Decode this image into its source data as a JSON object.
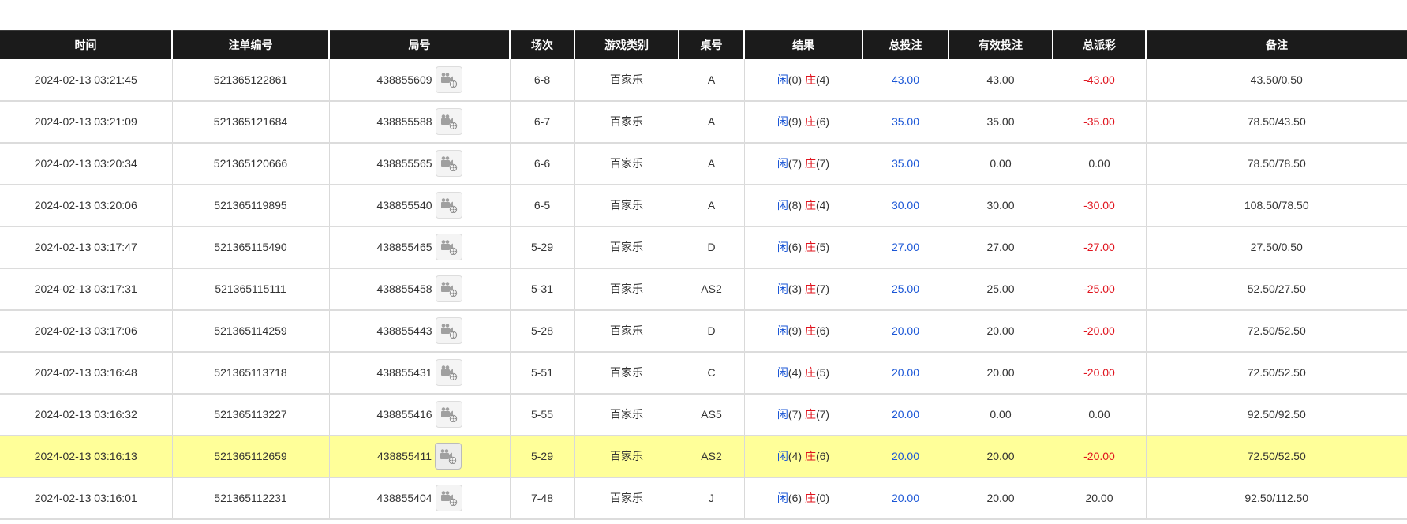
{
  "columns": [
    "时间",
    "注单编号",
    "局号",
    "场次",
    "游戏类别",
    "桌号",
    "结果",
    "总投注",
    "有效投注",
    "总派彩",
    "备注"
  ],
  "labels": {
    "player": "闲",
    "banker": "庄"
  },
  "icons": {
    "replay": "video-camera-icon"
  },
  "colors": {
    "header_bg": "#1b1b1b",
    "highlight": "#ffff99",
    "blue": "#1a56d6",
    "red": "#e0141e"
  },
  "rows": [
    {
      "time": "2024-02-13 03:21:45",
      "bet_id": "521365122861",
      "round": "438855609",
      "session": "6-8",
      "game": "百家乐",
      "table": "A",
      "player_score": "(0)",
      "banker_score": "(4)",
      "total_bet": "43.00",
      "valid_bet": "43.00",
      "payout": "-43.00",
      "note": "43.50/0.50"
    },
    {
      "time": "2024-02-13 03:21:09",
      "bet_id": "521365121684",
      "round": "438855588",
      "session": "6-7",
      "game": "百家乐",
      "table": "A",
      "player_score": "(9)",
      "banker_score": "(6)",
      "total_bet": "35.00",
      "valid_bet": "35.00",
      "payout": "-35.00",
      "note": "78.50/43.50"
    },
    {
      "time": "2024-02-13 03:20:34",
      "bet_id": "521365120666",
      "round": "438855565",
      "session": "6-6",
      "game": "百家乐",
      "table": "A",
      "player_score": "(7)",
      "banker_score": "(7)",
      "total_bet": "35.00",
      "valid_bet": "0.00",
      "payout": "0.00",
      "note": "78.50/78.50"
    },
    {
      "time": "2024-02-13 03:20:06",
      "bet_id": "521365119895",
      "round": "438855540",
      "session": "6-5",
      "game": "百家乐",
      "table": "A",
      "player_score": "(8)",
      "banker_score": "(4)",
      "total_bet": "30.00",
      "valid_bet": "30.00",
      "payout": "-30.00",
      "note": "108.50/78.50"
    },
    {
      "time": "2024-02-13 03:17:47",
      "bet_id": "521365115490",
      "round": "438855465",
      "session": "5-29",
      "game": "百家乐",
      "table": "D",
      "player_score": "(6)",
      "banker_score": "(5)",
      "total_bet": "27.00",
      "valid_bet": "27.00",
      "payout": "-27.00",
      "note": "27.50/0.50"
    },
    {
      "time": "2024-02-13 03:17:31",
      "bet_id": "521365115111",
      "round": "438855458",
      "session": "5-31",
      "game": "百家乐",
      "table": "AS2",
      "player_score": "(3)",
      "banker_score": "(7)",
      "total_bet": "25.00",
      "valid_bet": "25.00",
      "payout": "-25.00",
      "note": "52.50/27.50"
    },
    {
      "time": "2024-02-13 03:17:06",
      "bet_id": "521365114259",
      "round": "438855443",
      "session": "5-28",
      "game": "百家乐",
      "table": "D",
      "player_score": "(9)",
      "banker_score": "(6)",
      "total_bet": "20.00",
      "valid_bet": "20.00",
      "payout": "-20.00",
      "note": "72.50/52.50"
    },
    {
      "time": "2024-02-13 03:16:48",
      "bet_id": "521365113718",
      "round": "438855431",
      "session": "5-51",
      "game": "百家乐",
      "table": "C",
      "player_score": "(4)",
      "banker_score": "(5)",
      "total_bet": "20.00",
      "valid_bet": "20.00",
      "payout": "-20.00",
      "note": "72.50/52.50"
    },
    {
      "time": "2024-02-13 03:16:32",
      "bet_id": "521365113227",
      "round": "438855416",
      "session": "5-55",
      "game": "百家乐",
      "table": "AS5",
      "player_score": "(7)",
      "banker_score": "(7)",
      "total_bet": "20.00",
      "valid_bet": "0.00",
      "payout": "0.00",
      "note": "92.50/92.50"
    },
    {
      "time": "2024-02-13 03:16:13",
      "bet_id": "521365112659",
      "round": "438855411",
      "session": "5-29",
      "game": "百家乐",
      "table": "AS2",
      "player_score": "(4)",
      "banker_score": "(6)",
      "total_bet": "20.00",
      "valid_bet": "20.00",
      "payout": "-20.00",
      "note": "72.50/52.50",
      "highlighted": true
    },
    {
      "time": "2024-02-13 03:16:01",
      "bet_id": "521365112231",
      "round": "438855404",
      "session": "7-48",
      "game": "百家乐",
      "table": "J",
      "player_score": "(6)",
      "banker_score": "(0)",
      "total_bet": "20.00",
      "valid_bet": "20.00",
      "payout": "20.00",
      "note": "92.50/112.50"
    }
  ]
}
